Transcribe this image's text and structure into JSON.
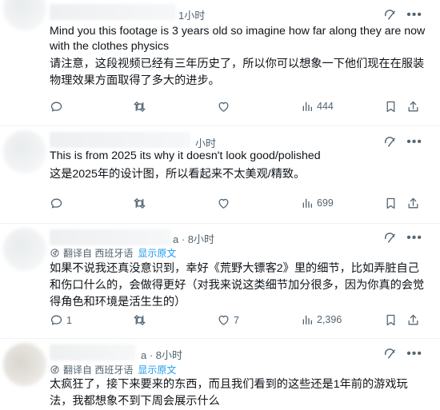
{
  "tweets": [
    {
      "time": "1小时",
      "text_en": "Mind you this footage is 3 years old so imagine how far along they are now with the clothes physics",
      "text_zh": "请注意，这段视频已经有三年历史了，所以你可以想象一下他们现在在服装物理效果方面取得了多大的进步。",
      "translated": false,
      "stats": {
        "replies": "",
        "retweets": "",
        "likes": "",
        "views": "444"
      }
    },
    {
      "time": "小时",
      "text_en": "This is from 2025 its why it doesn't look good/polished",
      "text_zh": "这是2025年的设计图，所以看起来不太美观/精致。",
      "translated": false,
      "stats": {
        "replies": "",
        "retweets": "",
        "likes": "",
        "views": "699"
      }
    },
    {
      "time": "a · 8小时",
      "translated": true,
      "translate_prefix": "翻译自 西班牙语",
      "show_original": "显示原文",
      "text_zh": "如果不说我还真没意识到，幸好《荒野大镖客2》里的细节，比如弄脏自己和伤口什么的，会做得更好（对我来说这类细节加分很多，因为你真的会觉得角色和环境是活生生的）",
      "stats": {
        "replies": "1",
        "retweets": "",
        "likes": "7",
        "views": "2,396"
      }
    },
    {
      "time": "a · 8小时",
      "translated": true,
      "translate_prefix": "翻译自 西班牙语",
      "show_original": "显示原文",
      "text_zh": "太疯狂了，接下来要来的东西，而且我们看到的这些还是1年前的游戏玩法，我都想象不到下周会展示什么"
    }
  ],
  "icons": [
    "grok-icon",
    "more-icon",
    "reply-icon",
    "retweet-icon",
    "like-icon",
    "views-icon",
    "bookmark-icon",
    "share-icon",
    "translate-icon"
  ],
  "colors": {
    "text": "#0f1419",
    "muted": "#536471",
    "link": "#1d9bf0",
    "border": "#eff3f4"
  }
}
